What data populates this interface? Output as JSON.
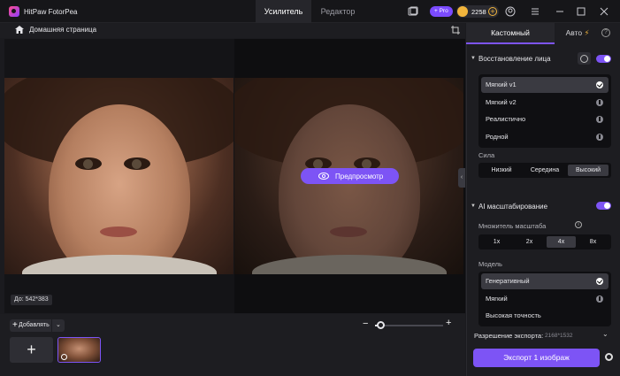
{
  "titlebar": {
    "app_name": "HitPaw FotorPea",
    "tabs": [
      "Усилитель",
      "Редактор"
    ],
    "pro_label": "+ Pro",
    "coins": "2258"
  },
  "breadcrumb": {
    "label": "Домашняя страница"
  },
  "canvas": {
    "preview_label": "Предпросмотр",
    "size_label": "До: 542*383"
  },
  "bottom": {
    "add_label": "Добавлять",
    "zoom": 0.08
  },
  "panel": {
    "tabs": [
      "Кастомный",
      "Авто"
    ],
    "face_section": {
      "title": "Восстановление лица",
      "options": [
        {
          "label": "Мягкий v1",
          "status": "selected"
        },
        {
          "label": "Мягкий v2",
          "status": "download"
        },
        {
          "label": "Реалистично",
          "status": "download"
        },
        {
          "label": "Родной",
          "status": "download"
        }
      ],
      "strength_label": "Сила",
      "strength_options": [
        "Низкий",
        "Середина",
        "Высокий"
      ],
      "strength_selected": "Высокий"
    },
    "upscale_section": {
      "title": "AI масштабирование",
      "scale_label": "Множитель масштаба",
      "scale_options": [
        "1x",
        "2x",
        "4x",
        "8x"
      ],
      "scale_selected": "4x",
      "model_label": "Модель",
      "models": [
        {
          "label": "Генеративный",
          "status": "selected"
        },
        {
          "label": "Мягкий",
          "status": "download"
        },
        {
          "label": "Высокая точность",
          "status": "none"
        }
      ]
    },
    "export_resolution_label": "Разрешение экспорта:",
    "export_resolution_value": "2168*1532",
    "export_button": "Экспорт 1 изображ"
  },
  "colors": {
    "accent": "#7d54f5",
    "background": "#1b1b1f"
  }
}
